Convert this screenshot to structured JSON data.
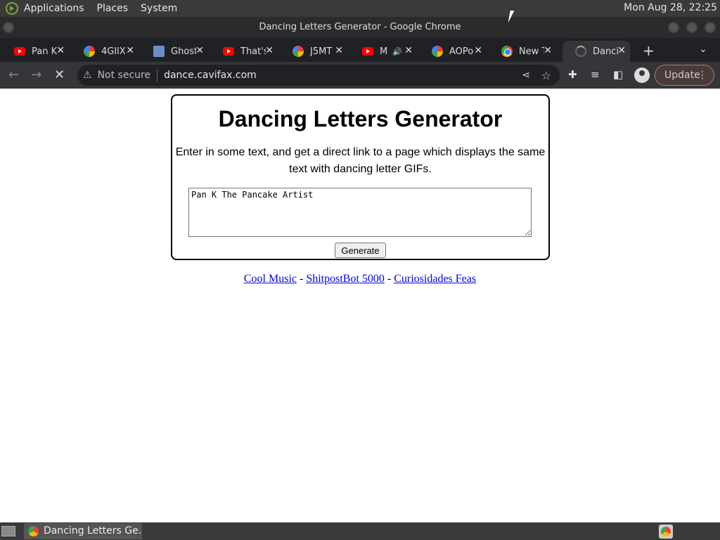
{
  "top_panel": {
    "menus": [
      "Applications",
      "Places",
      "System"
    ],
    "clock": "Mon Aug 28, 22:25"
  },
  "window": {
    "title": "Dancing Letters Generator - Google Chrome"
  },
  "tabs": [
    {
      "label": "Pan K",
      "icon": "youtube-icon"
    },
    {
      "label": "4GIlX",
      "icon": "pinwheel-icon"
    },
    {
      "label": "Ghost",
      "icon": "image-icon"
    },
    {
      "label": "That's",
      "icon": "youtube-icon"
    },
    {
      "label": "J5MT",
      "icon": "pinwheel-icon"
    },
    {
      "label": "M",
      "icon": "youtube-icon",
      "audio": "🔊"
    },
    {
      "label": "AOPo",
      "icon": "pinwheel-icon"
    },
    {
      "label": "New T",
      "icon": "chrome-icon"
    },
    {
      "label": "Dancin",
      "icon": "loading-icon",
      "active": true
    }
  ],
  "toolbar": {
    "security_label": "Not secure",
    "url": "dance.cavifax.com",
    "update_label": "Update"
  },
  "page": {
    "heading": "Dancing Letters Generator",
    "description": "Enter in some text, and get a direct link to a page which displays the same text with dancing letter GIFs.",
    "input_value": "Pan K The Pancake Artist",
    "generate_label": "Generate",
    "links": [
      "Cool Music",
      "ShitpostBot 5000",
      "Curiosidades Feas"
    ],
    "link_separator": "-"
  },
  "taskbar": {
    "task_label": "Dancing Letters Ge..."
  },
  "colors": {
    "link": "#0000ee",
    "update_border": "#b07a6e"
  }
}
